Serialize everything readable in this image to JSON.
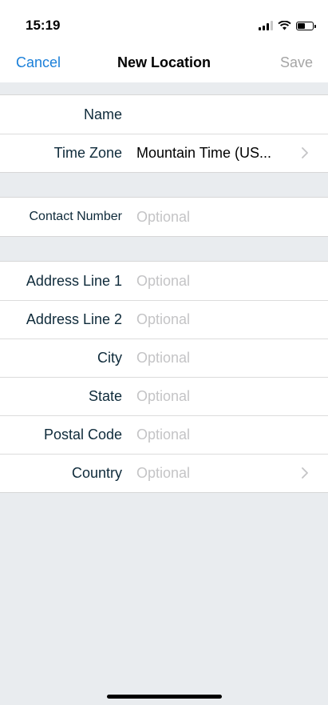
{
  "status": {
    "time": "15:19"
  },
  "nav": {
    "cancel": "Cancel",
    "title": "New Location",
    "save": "Save"
  },
  "groups": [
    {
      "rows": [
        {
          "label": "Name",
          "value": "",
          "placeholder": ""
        },
        {
          "label": "Time Zone",
          "value": "Mountain Time (US...",
          "placeholder": ""
        }
      ]
    },
    {
      "rows": [
        {
          "label": "Contact Number",
          "value": "",
          "placeholder": "Optional"
        }
      ]
    },
    {
      "rows": [
        {
          "label": "Address Line 1",
          "value": "",
          "placeholder": "Optional"
        },
        {
          "label": "Address Line 2",
          "value": "",
          "placeholder": "Optional"
        },
        {
          "label": "City",
          "value": "",
          "placeholder": "Optional"
        },
        {
          "label": "State",
          "value": "",
          "placeholder": "Optional"
        },
        {
          "label": "Postal Code",
          "value": "",
          "placeholder": "Optional"
        },
        {
          "label": "Country",
          "value": "",
          "placeholder": "Optional"
        }
      ]
    }
  ],
  "colors": {
    "accent": "#1a7fd9",
    "background": "#e9ecef",
    "placeholder": "#c4c4c6",
    "label": "#0e2a3a"
  }
}
